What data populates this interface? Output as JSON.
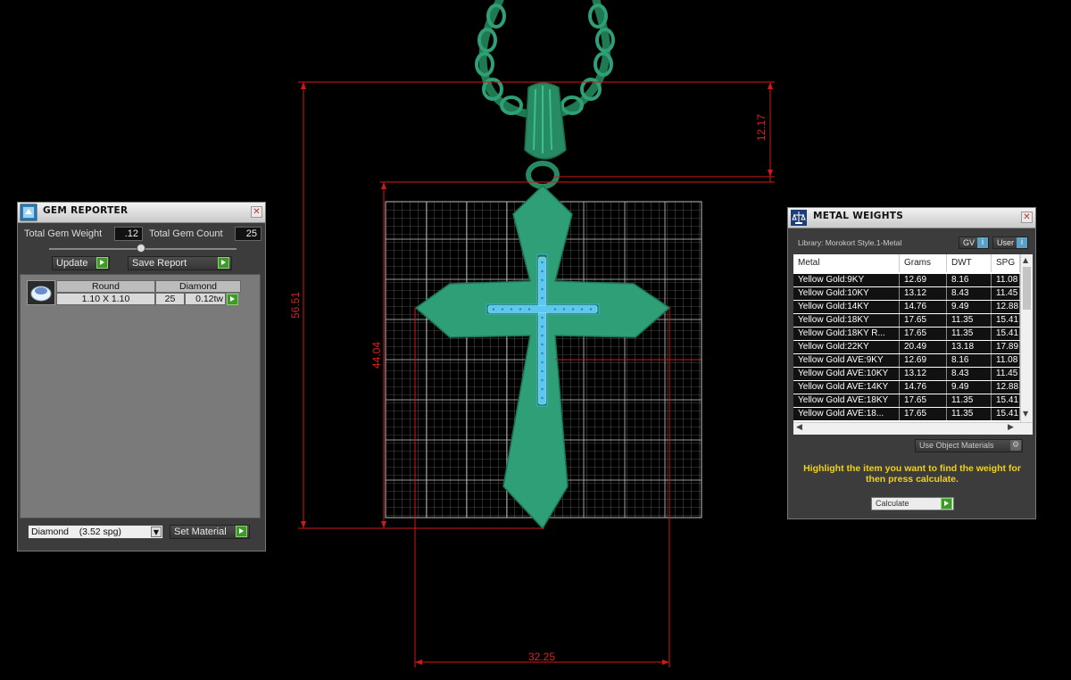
{
  "viewport": {
    "dimensions": {
      "height_total": "56.51",
      "height_cross": "44.04",
      "bail_height": "12.17",
      "width": "32.25"
    },
    "colors": {
      "metal": "#2e9f76",
      "gem": "#5cc8f0",
      "dim": "#d01818",
      "grid": "#b0b0b0"
    }
  },
  "gem_reporter": {
    "title": "GEM REPORTER",
    "total_weight_label": "Total Gem Weight",
    "total_weight_value": ".12",
    "total_count_label": "Total Gem Count",
    "total_count_value": "25",
    "update_label": "Update",
    "save_report_label": "Save Report",
    "table": {
      "shape_header": "Round",
      "material_header": "Diamond",
      "size": "1.10 X 1.10",
      "count": "25",
      "weight": "0.12tw"
    },
    "material_select": "Diamond    (3.52 spg)",
    "set_material_label": "Set Material"
  },
  "metal_weights": {
    "title": "METAL WEIGHTS",
    "library_label": "Library: Morokort Style.1-Metal",
    "gv_label": "GV",
    "user_label": "User",
    "columns": [
      "Metal",
      "Grams",
      "DWT",
      "SPG"
    ],
    "rows": [
      {
        "metal": "Yellow Gold:9KY",
        "grams": "12.69",
        "dwt": "8.16",
        "spg": "11.08"
      },
      {
        "metal": "Yellow Gold:10KY",
        "grams": "13.12",
        "dwt": "8.43",
        "spg": "11.45"
      },
      {
        "metal": "Yellow Gold:14KY",
        "grams": "14.76",
        "dwt": "9.49",
        "spg": "12.88"
      },
      {
        "metal": "Yellow Gold:18KY",
        "grams": "17.65",
        "dwt": "11.35",
        "spg": "15.41"
      },
      {
        "metal": "Yellow Gold:18KY R...",
        "grams": "17.65",
        "dwt": "11.35",
        "spg": "15.41"
      },
      {
        "metal": "Yellow Gold:22KY",
        "grams": "20.49",
        "dwt": "13.18",
        "spg": "17.89"
      },
      {
        "metal": "Yellow Gold AVE:9KY",
        "grams": "12.69",
        "dwt": "8.16",
        "spg": "11.08"
      },
      {
        "metal": "Yellow Gold AVE:10KY",
        "grams": "13.12",
        "dwt": "8.43",
        "spg": "11.45"
      },
      {
        "metal": "Yellow Gold AVE:14KY",
        "grams": "14.76",
        "dwt": "9.49",
        "spg": "12.88"
      },
      {
        "metal": "Yellow Gold AVE:18KY",
        "grams": "17.65",
        "dwt": "11.35",
        "spg": "15.41"
      },
      {
        "metal": "Yellow Gold AVE:18...",
        "grams": "17.65",
        "dwt": "11.35",
        "spg": "15.41"
      }
    ],
    "use_object_materials_label": "Use Object Materials",
    "hint": "Highlight the item you want to find the weight for then press calculate.",
    "calculate_label": "Calculate"
  }
}
